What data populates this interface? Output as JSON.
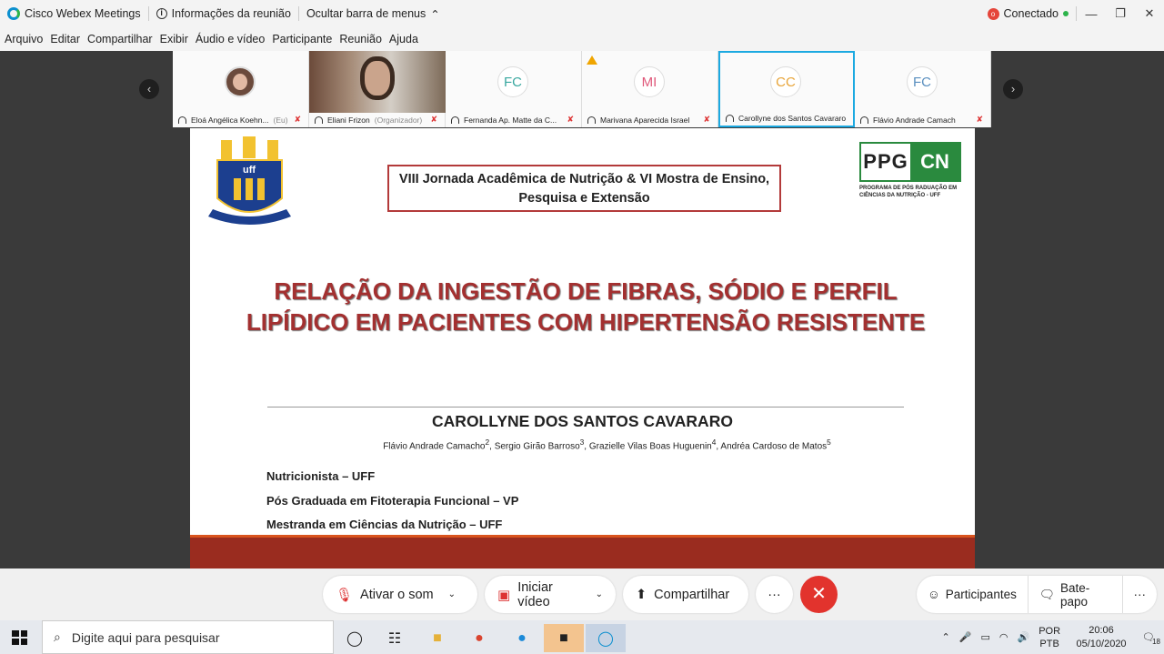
{
  "titlebar": {
    "app_name": "Cisco Webex Meetings",
    "meeting_info": "Informações da reunião",
    "hide_menu": "Ocultar barra de menus",
    "status": "Conectado"
  },
  "menu": [
    "Arquivo",
    "Editar",
    "Compartilhar",
    "Exibir",
    "Áudio e vídeo",
    "Participante",
    "Reunião",
    "Ajuda"
  ],
  "participants": [
    {
      "initials": "",
      "name": "Eloá Angélica Koehn...",
      "suffix": "(Eu)"
    },
    {
      "initials": "",
      "name": "Eliani Frizon",
      "suffix": "(Organizador)"
    },
    {
      "initials": "FC",
      "name": "Fernanda Ap. Matte da C...",
      "suffix": "",
      "color": "#3aa8a0"
    },
    {
      "initials": "MI",
      "name": "Marivana Aparecida Israel",
      "suffix": "",
      "color": "#e0587a"
    },
    {
      "initials": "CC",
      "name": "Carollyne dos Santos Cavararo",
      "suffix": "",
      "color": "#e8a53a"
    },
    {
      "initials": "FC",
      "name": "Flávio Andrade Camach",
      "suffix": "",
      "color": "#5a8fbf"
    }
  ],
  "slide": {
    "event": "VIII Jornada Acadêmica de Nutrição & VI Mostra de Ensino, Pesquisa e Extensão",
    "logo_left": "PPG",
    "logo_right": "CN",
    "logo_sub": "PROGRAMA DE PÓS RADUAÇÃO EM CIÊNCIAS DA NUTRIÇÃO - UFF",
    "crest_text": "uff",
    "title": "RELAÇÃO DA INGESTÃO DE FIBRAS, SÓDIO E PERFIL LIPÍDICO EM PACIENTES COM HIPERTENSÃO RESISTENTE",
    "author": "CAROLLYNE DOS SANTOS CAVARARO",
    "coauthors": [
      {
        "name": "Flávio Andrade Camacho",
        "sup": "2"
      },
      {
        "name": "Sergio Girão Barroso",
        "sup": "3"
      },
      {
        "name": "Grazielle Vilas Boas Huguenin",
        "sup": "4"
      },
      {
        "name": "Andréa Cardoso de Matos",
        "sup": "5"
      }
    ],
    "affiliations": [
      "Nutricionista – UFF",
      "Pós Graduada em Fitoterapia Funcional – VP",
      "Mestranda em Ciências da Nutrição – UFF"
    ]
  },
  "controls": {
    "unmute": "Ativar o som",
    "start_video": "Iniciar vídeo",
    "share": "Compartilhar",
    "more": "···",
    "participants": "Participantes",
    "chat": "Bate-papo"
  },
  "taskbar": {
    "search_placeholder": "Digite aqui para pesquisar",
    "lang_top": "POR",
    "lang_bottom": "PTB",
    "time": "20:06",
    "date": "05/10/2020",
    "notifications": "18"
  }
}
